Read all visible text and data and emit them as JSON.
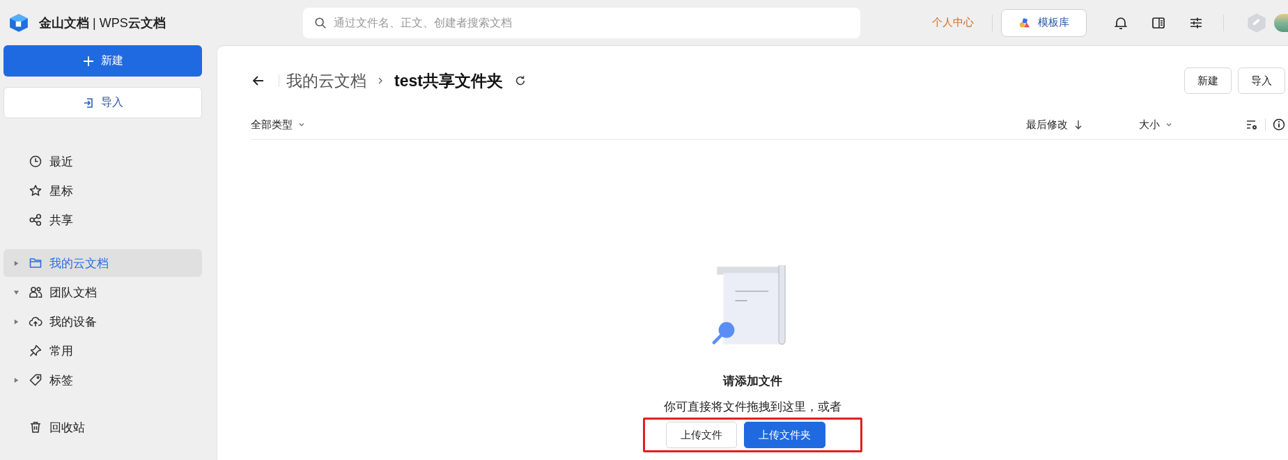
{
  "app": {
    "title_bold": "金山文档",
    "title_sep": "|",
    "title_rest": "WPS",
    "title_tail": "云文档"
  },
  "search": {
    "placeholder": "通过文件名、正文、创建者搜索文档"
  },
  "top_actions": {
    "personal_center": "个人中心",
    "template_button": "模板库"
  },
  "sidebar": {
    "new_button": "新建",
    "import_button": "导入",
    "groups": [
      [
        {
          "label": "最近",
          "kind": "link",
          "selected": false
        },
        {
          "label": "星标",
          "kind": "link",
          "selected": false
        },
        {
          "label": "共享",
          "kind": "link",
          "selected": false
        }
      ],
      [
        {
          "label": "我的云文档",
          "kind": "tree",
          "expanded": false,
          "selected": true
        },
        {
          "label": "团队文档",
          "kind": "tree",
          "expanded": true,
          "selected": false
        },
        {
          "label": "我的设备",
          "kind": "tree",
          "expanded": false,
          "selected": false
        },
        {
          "label": "常用",
          "kind": "link",
          "selected": false
        },
        {
          "label": "标签",
          "kind": "tree",
          "expanded": false,
          "selected": false
        }
      ],
      [
        {
          "label": "回收站",
          "kind": "link",
          "selected": false
        }
      ]
    ]
  },
  "breadcrumb": {
    "parent": "我的云文档",
    "current": "test共享文件夹"
  },
  "header_buttons": [
    "新建",
    "导入"
  ],
  "columns": [
    {
      "label": "全部类型",
      "kind": "dropdown"
    },
    {
      "label": "最后修改",
      "kind": "sort"
    },
    {
      "label": "大小",
      "kind": "dropdown"
    }
  ],
  "empty_state": {
    "title": "请添加文件",
    "text": "你可直接将文件拖拽到这里，或者",
    "buttons": [
      {
        "label": "上传文件",
        "kind": "secondary"
      },
      {
        "label": "上传文件夹",
        "kind": "primary"
      }
    ],
    "highlighted": true
  }
}
